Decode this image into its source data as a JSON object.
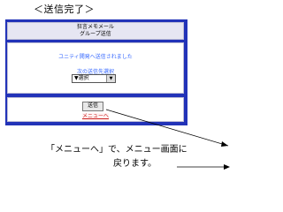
{
  "caption_top": "＜送信完了＞",
  "header": {
    "line1": "狂言メモメール",
    "line2": "グループ送信"
  },
  "body": {
    "message": "ユニティ開発へ送信されました",
    "next_label": "次の送信先選択",
    "select_value": "▼選択"
  },
  "footer": {
    "send_label": "送信",
    "menu_label": "メニューへ"
  },
  "caption_bottom": {
    "line1": "「メニューへ」で、メニュー画面に",
    "line2": "戻ります。"
  },
  "colors": {
    "frame": "#2233b8",
    "link": "#3366ff",
    "menu_link": "#cc2222"
  }
}
